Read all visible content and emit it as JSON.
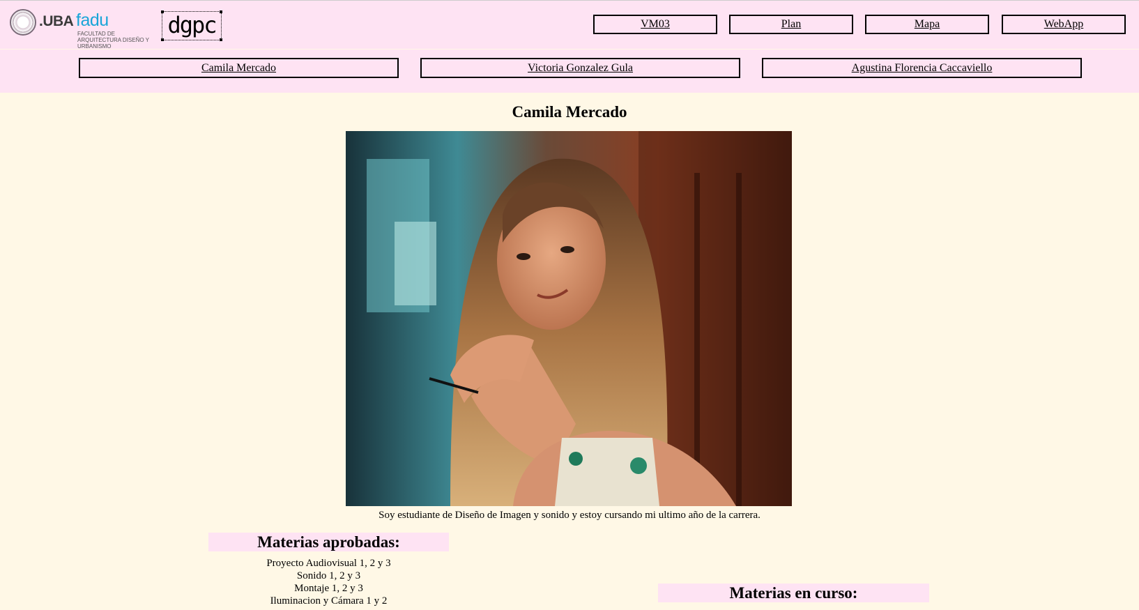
{
  "header": {
    "uba_logo_text": ".UBA",
    "fadu_logo_text": "fadu",
    "fadu_subtitle": "FACULTAD DE ARQUITECTURA DISEÑO Y URBANISMO",
    "dgpc_logo_text": "dgpc",
    "nav": [
      {
        "label": "VM03"
      },
      {
        "label": "Plan"
      },
      {
        "label": "Mapa"
      },
      {
        "label": "WebApp"
      }
    ]
  },
  "members_nav": [
    {
      "label": "Camila Mercado"
    },
    {
      "label": "Victoria Gonzalez Gula"
    },
    {
      "label": "Agustina Florencia Caccaviello"
    }
  ],
  "profile": {
    "name": "Camila Mercado",
    "bio": "Soy estudiante de Diseño de Imagen y sonido y estoy cursando mi ultimo año de la carrera."
  },
  "approved": {
    "title": "Materias aprobadas:",
    "items": [
      "Proyecto Audiovisual 1, 2 y 3",
      "Sonido 1, 2 y 3",
      "Montaje 1, 2 y 3",
      "Iluminacion y Cámara 1 y 2"
    ]
  },
  "current": {
    "title": "Materias en curso:"
  },
  "colors": {
    "page_bg": "#fff8e6",
    "header_bg": "#fee3f3",
    "fadu_blue": "#19a5d8"
  }
}
